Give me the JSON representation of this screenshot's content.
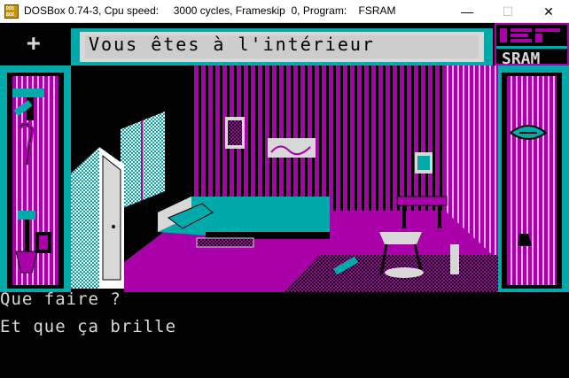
{
  "window": {
    "title": "DOSBox 0.74-3, Cpu speed:     3000 cycles, Frameskip  0, Program:    FSRAM",
    "icon_text_1": "DOS",
    "icon_text_2": "BOX",
    "minimize_glyph": "—",
    "maximize_glyph": "☐",
    "close_glyph": "✕"
  },
  "game": {
    "location_banner": "Vous êtes à l'intérieur",
    "plus_button": "+",
    "logo_text": "ERE",
    "logo_subtext": "SRAM",
    "prompt": "Que faire ?",
    "response": "Et que ça brille"
  },
  "colors": {
    "cyan": "#00aaaa",
    "magenta": "#aa00aa",
    "light_gray": "#d8d8d8",
    "black": "#000000",
    "white": "#ffffff"
  },
  "icons": {
    "left_panel": [
      "hammer-icon",
      "crowbar-icon",
      "shovel-icon",
      "bag-icon"
    ],
    "right_panel": [
      "mouth-icon",
      "foot-icon"
    ]
  }
}
